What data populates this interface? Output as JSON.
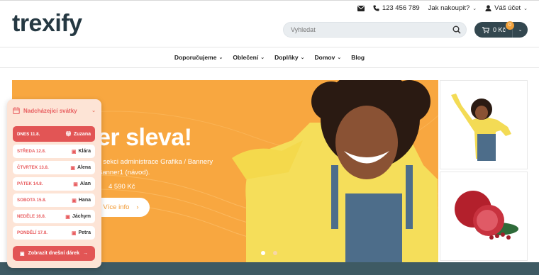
{
  "header": {
    "logo": "trexify",
    "phone": "123 456 789",
    "how_to_buy": "Jak nakoupit?",
    "account": "Váš účet"
  },
  "search": {
    "placeholder": "Vyhledat"
  },
  "cart": {
    "total": "0 Kč",
    "count": "0"
  },
  "nav": {
    "items": [
      {
        "label": "Doporučujeme",
        "dropdown": true
      },
      {
        "label": "Oblečení",
        "dropdown": true
      },
      {
        "label": "Doplňky",
        "dropdown": true
      },
      {
        "label": "Domov",
        "dropdown": true
      },
      {
        "label": "Blog",
        "dropdown": false
      }
    ]
  },
  "hero": {
    "title": "er sleva!",
    "text_line1": "v sekci administrace Grafika / Bannery",
    "text_line2": "Banner1 (návod).",
    "price": "4 590 Kč",
    "button": "Více info",
    "slides": 2,
    "active_slide": 1
  },
  "holidays": {
    "title": "Nadcházející svátky",
    "rows": [
      {
        "day": "DNES 11.8.",
        "name": "Zuzana",
        "today": true
      },
      {
        "day": "STŘEDA 12.8.",
        "name": "Klára",
        "today": false
      },
      {
        "day": "ČTVRTEK 13.8.",
        "name": "Alena",
        "today": false
      },
      {
        "day": "PÁTEK 14.8.",
        "name": "Alan",
        "today": false
      },
      {
        "day": "SOBOTA 15.8.",
        "name": "Hana",
        "today": false
      },
      {
        "day": "NEDĚLE 16.8.",
        "name": "Jáchym",
        "today": false
      },
      {
        "day": "PONDĚLÍ 17.8.",
        "name": "Petra",
        "today": false
      }
    ],
    "button": "Zobrazit dnešní dárek"
  },
  "colors": {
    "brand_dark": "#33474f",
    "hero_orange": "#f8a740",
    "accent_red": "#e25555",
    "badge": "#f0a03a"
  }
}
